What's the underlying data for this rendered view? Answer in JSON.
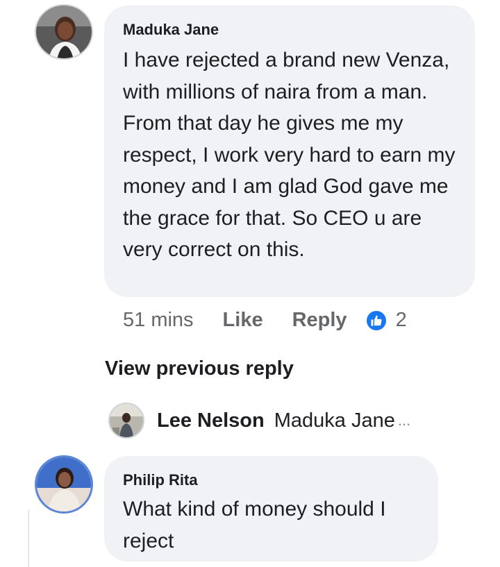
{
  "comments": [
    {
      "author": "Maduka Jane",
      "text": "I have rejected a brand new Venza, with millions of naira from a man. From that day he gives me my respect, I work very hard to earn my money and I am glad God gave me the grace for that.  So CEO  u are very correct on this.",
      "time": "51 mins",
      "like_label": "Like",
      "reply_label": "Reply",
      "reaction_count": "2"
    },
    {
      "author": "Philip Rita",
      "text": "What kind of money should I reject"
    }
  ],
  "view_previous_reply": "View previous reply",
  "reply_preview": {
    "author": "Lee Nelson",
    "snippet": "Maduka Jane",
    "ellipsis": "..."
  },
  "colors": {
    "bubble": "#f0f2f5",
    "meta_text": "#65676b",
    "like_blue": "#1877f2"
  },
  "icons": {
    "reaction": "thumbs-up-icon"
  }
}
